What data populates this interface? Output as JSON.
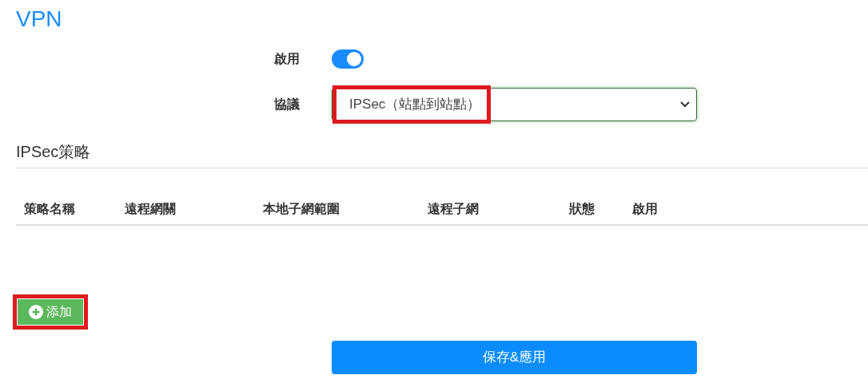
{
  "title": "VPN",
  "form": {
    "enable": {
      "label": "啟用",
      "on": true
    },
    "protocol": {
      "label": "協議",
      "value": "IPSec（站點到站點）",
      "highlighted": true
    }
  },
  "section": {
    "title": "IPSec策略"
  },
  "table": {
    "columns": [
      "策略名稱",
      "遠程網關",
      "本地子網範圍",
      "遠程子網",
      "狀態",
      "啟用"
    ]
  },
  "add_button": {
    "label": "添加",
    "highlighted": true
  },
  "save_button": {
    "label": "保存&應用"
  }
}
